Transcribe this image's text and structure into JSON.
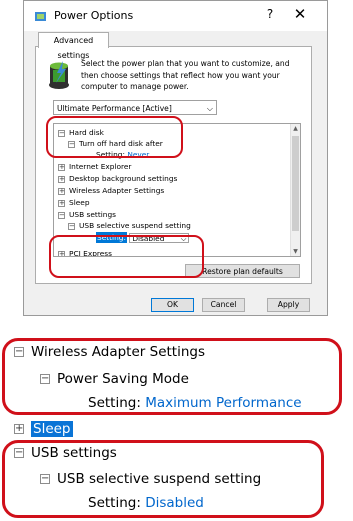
{
  "window": {
    "title": "Power Options",
    "help": "?",
    "close": "✕",
    "tab": "Advanced settings",
    "description": "Select the power plan that you want to customize, and then choose settings that reflect how you want your computer to manage power.",
    "plan_selected": "Ultimate Performance [Active]"
  },
  "tree": {
    "hard_disk": "Hard disk",
    "turn_off": "Turn off hard disk after",
    "setting_label": "Setting:",
    "setting_never": "Never",
    "internet_explorer": "Internet Explorer",
    "desktop_bg": "Desktop background settings",
    "wireless": "Wireless Adapter Settings",
    "sleep": "Sleep",
    "usb": "USB settings",
    "usb_suspend": "USB selective suspend setting",
    "usb_setting_label": "Setting:",
    "usb_setting_value": "Disabled",
    "cut_off": "PCI Express"
  },
  "buttons": {
    "restore": "Restore plan defaults",
    "ok": "OK",
    "cancel": "Cancel",
    "apply": "Apply"
  },
  "zoom": {
    "wireless": "Wireless Adapter Settings",
    "power_saving": "Power Saving Mode",
    "setting_label": "Setting:",
    "setting_value": "Maximum Performance",
    "sleep": "Sleep",
    "usb": "USB settings",
    "usb_suspend": "USB selective suspend setting",
    "usb_setting_label": "Setting:",
    "usb_setting_value": "Disabled"
  },
  "colors": {
    "highlight_red": "#d0101a",
    "link_blue": "#0066cc",
    "selection_blue": "#0078d7"
  }
}
